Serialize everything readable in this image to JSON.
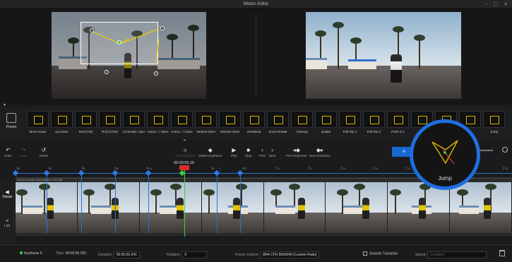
{
  "window": {
    "title": "Motion Editor"
  },
  "preview": {
    "left_label": "",
    "right_label": ""
  },
  "preset_button": {
    "label": "Preset"
  },
  "presets": [
    "Move Down",
    "Up-Down",
    "Roll (CW)",
    "Roll (CCW)",
    "Cinematic Open",
    "Horizo...l Open",
    "Horizo...l Close",
    "Vertical Open",
    "Vertical Close",
    "Heartbeat",
    "Zoom Rotate",
    "Closeup",
    "Quake",
    "Pull Out 1",
    "Pull Out 2",
    "Push In 1",
    "",
    "",
    "",
    "Jump"
  ],
  "toolbar": {
    "undo": "Undo",
    "redo": "Redo",
    "reset": "Reset",
    "add_keyframe": "Add Keyframe",
    "delete_keyframe": "Delete Keyframe",
    "play": "Play",
    "stop": "Stop",
    "prev": "Prev",
    "next": "Next",
    "prev_keyframe": "Prev Keyframe",
    "next_keyframe": "Next Keyframe",
    "auto_label": "A"
  },
  "timeline": {
    "current_time": "00:00:05.25",
    "clip_name": "pexels-rodnae-productions-7224780",
    "ticks": [
      "0",
      "1",
      "2",
      "3",
      "4",
      "5",
      "6",
      "7",
      "8",
      "9",
      "10",
      "11",
      "12",
      "13",
      "14",
      "15"
    ],
    "keyframes": [
      "1",
      "2",
      "3",
      "4",
      "5",
      "6",
      "7",
      "8"
    ],
    "current_keyframe": "6"
  },
  "sidebar": {
    "visual": "Visual",
    "list": "List"
  },
  "zoom_preview": {
    "label": "Jump"
  },
  "bottom": {
    "keyframe_label": "Keyframe 6",
    "time_label": "Time:",
    "time_value": "00:00:05.250",
    "duration_label": "Duration:",
    "duration_value": "00:00:01.041",
    "rotation_label": "Rotation:",
    "rotation_value": "0",
    "frame_control_label": "Frame Control:",
    "frame_control_value": "(844,724)  960x540  [Custom Ratio]",
    "smooth_label": "Smooth Transition",
    "speed_label": "Speed:",
    "speed_value": "Constant"
  },
  "colors": {
    "accent": "#1e6ee0",
    "keyframe": "#2c7be5",
    "current": "#3ad03a",
    "playhead": "#d92b2b",
    "crop": "#d4b400"
  }
}
